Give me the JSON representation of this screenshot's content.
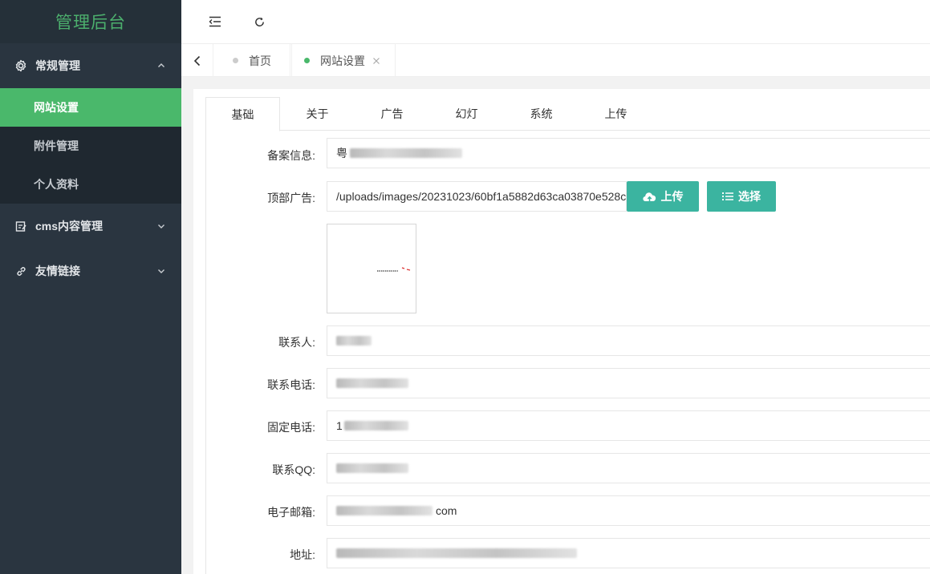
{
  "sidebar": {
    "logo": "管理后台",
    "groups": [
      {
        "label": "常规管理",
        "icon": "gear-icon",
        "expanded": true,
        "items": [
          {
            "label": "网站设置",
            "active": true
          },
          {
            "label": "附件管理",
            "active": false
          },
          {
            "label": "个人资料",
            "active": false
          }
        ]
      },
      {
        "label": "cms内容管理",
        "icon": "edit-icon",
        "expanded": false
      },
      {
        "label": "友情链接",
        "icon": "link-icon",
        "expanded": false
      }
    ]
  },
  "topbar": {
    "menu_toggle_icon": "menu-fold-icon",
    "refresh_icon": "refresh-icon"
  },
  "tabs": [
    {
      "label": "首页",
      "dot_color": "#cccccc",
      "closable": false
    },
    {
      "label": "网站设置",
      "dot_color": "#4ab86b",
      "closable": true
    }
  ],
  "content_tabs": [
    "基础",
    "关于",
    "广告",
    "幻灯",
    "系统",
    "上传"
  ],
  "form": {
    "beian": {
      "label": "备案信息:",
      "value": "粤"
    },
    "top_ad": {
      "label": "顶部广告:",
      "value": "/uploads/images/20231023/60bf1a5882d63ca03870e528c"
    },
    "upload_button": "上传",
    "select_button": "选择",
    "contact": {
      "label": "联系人:"
    },
    "phone": {
      "label": "联系电话:"
    },
    "tel": {
      "label": "固定电话:",
      "value": "1"
    },
    "qq": {
      "label": "联系QQ:"
    },
    "email": {
      "label": "电子邮箱:",
      "value": "com"
    },
    "address": {
      "label": "地址:"
    }
  },
  "colors": {
    "accent": "#4ab86b",
    "button": "#3bb4a0",
    "sidebar_bg": "#2a3540"
  }
}
